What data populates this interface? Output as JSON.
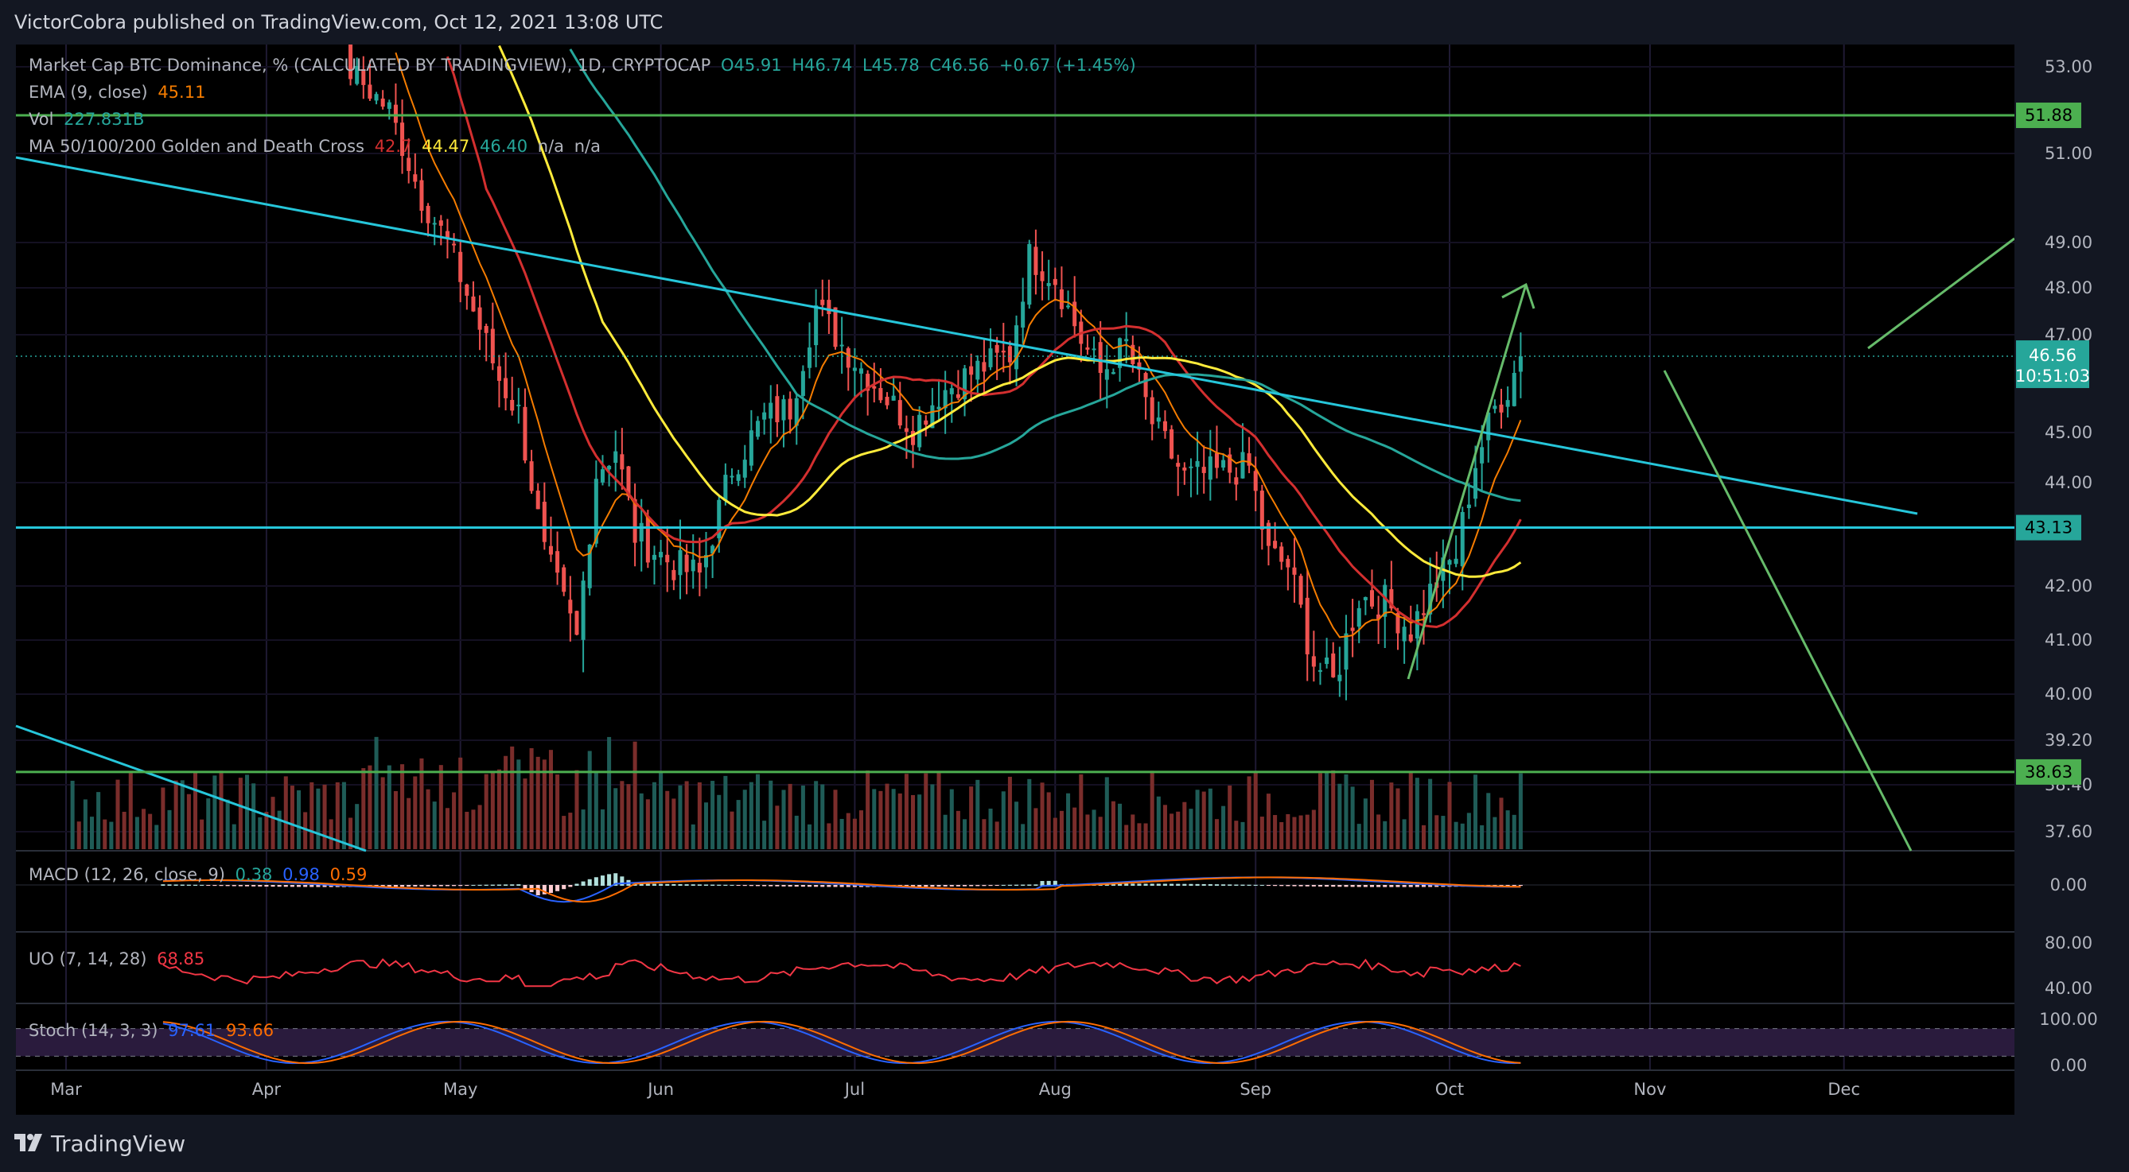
{
  "header": {
    "publisher": "VictorCobra published on TradingView.com, Oct 12, 2021 13:08 UTC"
  },
  "footer": {
    "brand": "TradingView"
  },
  "legends": {
    "main": {
      "name": "Market Cap BTC Dominance, % (CALCULATED BY TRADINGVIEW), 1D, CRYPTOCAP",
      "o": "O45.91",
      "h": "H46.74",
      "l": "L45.78",
      "c": "C46.56",
      "chg": "+0.67 (+1.45%)"
    },
    "ema": {
      "name": "EMA (9, close)",
      "value": "45.11"
    },
    "vol": {
      "name": "Vol",
      "value": "227.831B"
    },
    "ma": {
      "name": "MA 50/100/200 Golden and Death Cross",
      "v1": "42.7",
      "v2": "44.47",
      "v3": "46.40",
      "v4": "n/a",
      "v5": "n/a"
    },
    "macd": {
      "name": "MACD (12, 26, close, 9)",
      "v1": "0.38",
      "v2": "0.98",
      "v3": "0.59"
    },
    "uo": {
      "name": "UO (7, 14, 28)",
      "value": "68.85"
    },
    "stoch": {
      "name": "Stoch (14, 3, 3)",
      "v1": "97.61",
      "v2": "93.66"
    }
  },
  "price_badges": {
    "level_top": "51.88",
    "last": "46.56",
    "countdown": "10:51:03",
    "level_mid": "43.13",
    "level_low": "38.63"
  },
  "colors": {
    "up": "#26a69a",
    "down": "#ef5350",
    "ema": "#f57c00",
    "ma50": "#d32f2f",
    "ma100": "#ffeb3b",
    "ma200": "#26a69a",
    "trend": "#26c6da",
    "level": "#4caf50",
    "arrow": "#66bb6a",
    "macd": "#2962ff",
    "signal": "#ff6d00",
    "uo": "#f23645",
    "stoch_k": "#2962ff",
    "stoch_d": "#ff6d00"
  },
  "chart_data": [
    {
      "type": "candlestick",
      "title": "Market Cap BTC Dominance, % (CALCULATED BY TRADINGVIEW), 1D, CRYPTOCAP",
      "x_ticks": [
        "Mar",
        "Apr",
        "May",
        "Jun",
        "Jul",
        "Aug",
        "Sep",
        "Oct",
        "Nov",
        "Dec"
      ],
      "y_ticks": [
        "53.00",
        "51.00",
        "49.00",
        "48.00",
        "47.00",
        "45.00",
        "44.00",
        "42.00",
        "41.00",
        "40.00",
        "39.20",
        "38.40",
        "37.60"
      ],
      "ylim": [
        37.3,
        53.4
      ],
      "horizontal_levels": [
        51.88,
        43.13,
        38.63
      ],
      "last_close": 46.56,
      "close_anchors": [
        [
          "2021-04-14",
          52.9
        ],
        [
          "2021-04-20",
          52.0
        ],
        [
          "2021-04-25",
          50.0
        ],
        [
          "2021-04-29",
          49.0
        ],
        [
          "2021-05-03",
          47.5
        ],
        [
          "2021-05-07",
          46.1
        ],
        [
          "2021-05-10",
          45.4
        ],
        [
          "2021-05-14",
          42.6
        ],
        [
          "2021-05-19",
          41.0
        ],
        [
          "2021-05-22",
          44.2
        ],
        [
          "2021-05-25",
          44.7
        ],
        [
          "2021-05-28",
          43.0
        ],
        [
          "2021-06-03",
          42.4
        ],
        [
          "2021-06-07",
          42.2
        ],
        [
          "2021-06-12",
          44.3
        ],
        [
          "2021-06-17",
          45.3
        ],
        [
          "2021-06-21",
          45.5
        ],
        [
          "2021-06-25",
          47.6
        ],
        [
          "2021-06-29",
          46.8
        ],
        [
          "2021-07-04",
          46.0
        ],
        [
          "2021-07-10",
          45.1
        ],
        [
          "2021-07-14",
          45.8
        ],
        [
          "2021-07-20",
          46.3
        ],
        [
          "2021-07-25",
          46.6
        ],
        [
          "2021-07-28",
          48.7
        ],
        [
          "2021-08-01",
          48.2
        ],
        [
          "2021-08-05",
          46.9
        ],
        [
          "2021-08-08",
          46.2
        ],
        [
          "2021-08-12",
          46.8
        ],
        [
          "2021-08-16",
          45.2
        ],
        [
          "2021-08-21",
          44.1
        ],
        [
          "2021-08-26",
          44.2
        ],
        [
          "2021-08-31",
          44.3
        ],
        [
          "2021-09-03",
          42.6
        ],
        [
          "2021-09-06",
          42.4
        ],
        [
          "2021-09-10",
          40.6
        ],
        [
          "2021-09-13",
          40.2
        ],
        [
          "2021-09-17",
          41.8
        ],
        [
          "2021-09-21",
          41.7
        ],
        [
          "2021-09-25",
          41.2
        ],
        [
          "2021-09-29",
          42.1
        ],
        [
          "2021-10-02",
          42.6
        ],
        [
          "2021-10-05",
          44.4
        ],
        [
          "2021-10-08",
          45.5
        ],
        [
          "2021-10-10",
          45.9
        ],
        [
          "2021-10-12",
          46.56
        ]
      ],
      "ema9_value": 45.11,
      "ma_values": {
        "ma50": 42.7,
        "ma100": 44.47,
        "ma200": 46.4
      }
    },
    {
      "type": "bar",
      "title": "Vol",
      "last_value": "227.831B"
    },
    {
      "type": "line",
      "title": "MACD (12, 26, close, 9)",
      "y_ticks": [
        "0.00"
      ],
      "values": {
        "histogram": 0.38,
        "macd": 0.98,
        "signal": 0.59
      }
    },
    {
      "type": "line",
      "title": "UO (7, 14, 28)",
      "y_ticks": [
        "80.00",
        "40.00"
      ],
      "last_value": 68.85
    },
    {
      "type": "line",
      "title": "Stoch (14, 3, 3)",
      "y_ticks": [
        "100.00",
        "0.00"
      ],
      "values": {
        "k": 97.61,
        "d": 93.66
      }
    }
  ]
}
